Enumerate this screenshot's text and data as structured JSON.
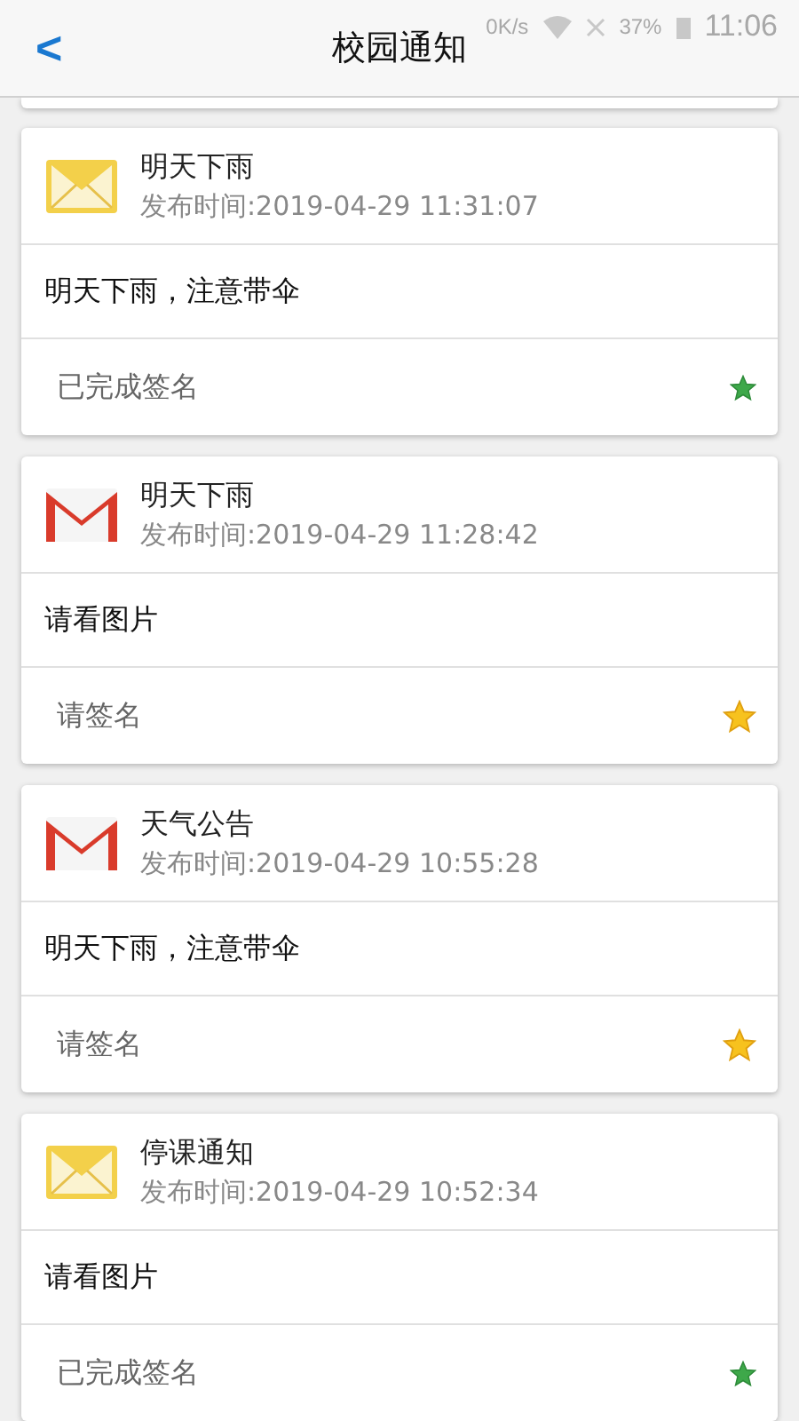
{
  "status_bar": {
    "speed": "0K/s",
    "battery": "37%",
    "time": "11:06"
  },
  "header": {
    "back": "<",
    "title": "校园通知"
  },
  "notices": [
    {
      "title": "明天下雨",
      "time": "发布时间:2019-04-29 11:31:07",
      "body": "明天下雨，注意带伞",
      "status": "已完成签名",
      "signed": true
    },
    {
      "title": "明天下雨",
      "time": "发布时间:2019-04-29 11:28:42",
      "body": "请看图片",
      "status": "请签名",
      "signed": false
    },
    {
      "title": "天气公告",
      "time": "发布时间:2019-04-29 10:55:28",
      "body": "明天下雨，注意带伞",
      "status": "请签名",
      "signed": false
    },
    {
      "title": "停课通知",
      "time": "发布时间:2019-04-29 10:52:34",
      "body": "请看图片",
      "status": "已完成签名",
      "signed": true
    }
  ]
}
